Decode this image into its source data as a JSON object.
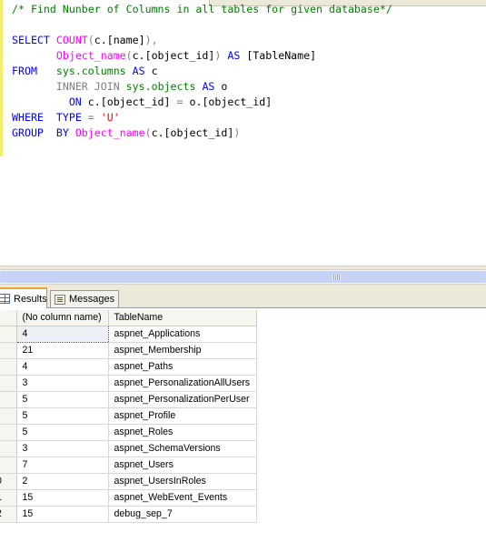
{
  "editor": {
    "comment": "/* Find Nunber of Columns in all tables for given database*/",
    "sql": {
      "select_kw": "SELECT",
      "count_fn": "COUNT",
      "count_arg": "(c.[name]),",
      "object_name_fn": "Object_name",
      "object_name_arg1": "(c.[object_id])",
      "as_kw": "AS",
      "alias": "[TableName]",
      "from_kw": "FROM",
      "sys_columns": "sys.columns",
      "alias_c": "c",
      "inner_join": "INNER JOIN",
      "sys_objects": "sys.objects",
      "alias_o": "o",
      "on_kw": "ON",
      "on_cond": "c.[object_id] = o.[object_id]",
      "where_kw": "WHERE",
      "type_kw": "TYPE",
      "equals": "=",
      "type_val": "'U'",
      "group_kw": "GROUP",
      "by_kw": "BY",
      "group_fn": "Object_name",
      "group_arg": "(c.[object_id])"
    }
  },
  "tabs": [
    {
      "label": "Results",
      "icon": "grid-icon",
      "active": true
    },
    {
      "label": "Messages",
      "icon": "messages-icon",
      "active": false
    }
  ],
  "grid": {
    "columns": [
      "(No column name)",
      "TableName"
    ],
    "rows": [
      {
        "row_num": "",
        "count": "4",
        "table": "aspnet_Applications"
      },
      {
        "row_num": "",
        "count": "21",
        "table": "aspnet_Membership"
      },
      {
        "row_num": "",
        "count": "4",
        "table": "aspnet_Paths"
      },
      {
        "row_num": "",
        "count": "3",
        "table": "aspnet_PersonalizationAllUsers"
      },
      {
        "row_num": "",
        "count": "5",
        "table": "aspnet_PersonalizationPerUser"
      },
      {
        "row_num": "",
        "count": "5",
        "table": "aspnet_Profile"
      },
      {
        "row_num": "",
        "count": "5",
        "table": "aspnet_Roles"
      },
      {
        "row_num": "",
        "count": "3",
        "table": "aspnet_SchemaVersions"
      },
      {
        "row_num": "",
        "count": "7",
        "table": "aspnet_Users"
      },
      {
        "row_num": "0",
        "count": "2",
        "table": "aspnet_UsersInRoles"
      },
      {
        "row_num": "1",
        "count": "15",
        "table": "aspnet_WebEvent_Events"
      },
      {
        "row_num": "2",
        "count": "15",
        "table": "debug_sep_7"
      }
    ]
  },
  "colors": {
    "keyword": "#0000ff",
    "function": "#ff00ff",
    "comment": "#008000",
    "string": "#ff0000",
    "gutter": "#f2ef6c",
    "active_tab_accent": "#f1a43a"
  }
}
